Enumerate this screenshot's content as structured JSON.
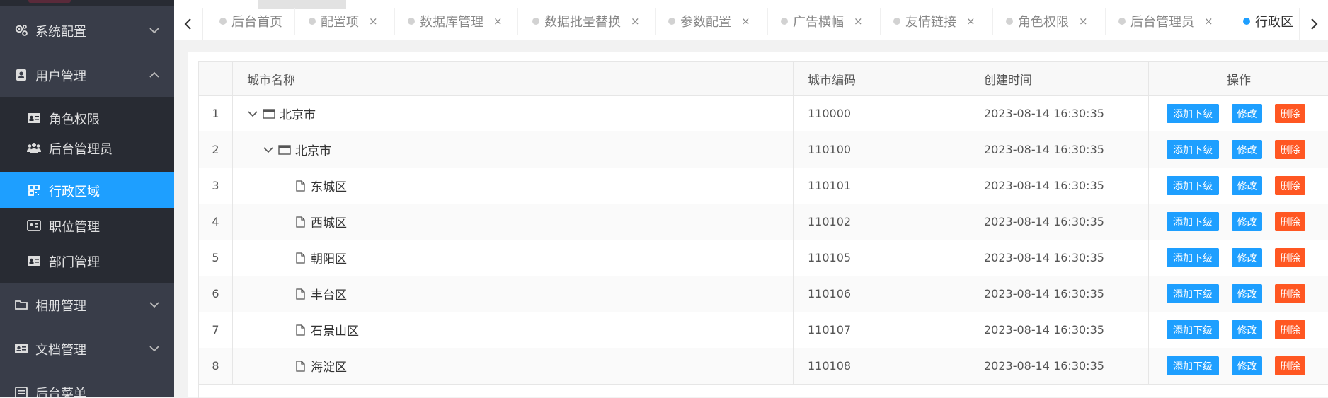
{
  "sidebar": {
    "groups": [
      {
        "label": "系统配置",
        "icon": "gears-icon",
        "expanded": false
      },
      {
        "label": "用户管理",
        "icon": "user-card-icon",
        "expanded": true
      },
      {
        "label": "相册管理",
        "icon": "folder-icon",
        "expanded": false
      },
      {
        "label": "文档管理",
        "icon": "id-card-icon",
        "expanded": false
      },
      {
        "label": "后台菜单",
        "icon": "menu-icon",
        "expanded": false
      }
    ],
    "sub_items": [
      {
        "label": "角色权限",
        "icon": "id-card-icon",
        "active": false
      },
      {
        "label": "后台管理员",
        "icon": "users-icon",
        "active": false
      },
      {
        "label": "行政区域",
        "icon": "qrcode-icon",
        "active": true
      },
      {
        "label": "职位管理",
        "icon": "id-card-icon",
        "active": false
      },
      {
        "label": "部门管理",
        "icon": "id-card-icon",
        "active": false
      }
    ],
    "colors": {
      "bg": "#393d49",
      "sub_bg": "#282b33",
      "active": "#1e9fff"
    }
  },
  "tabs": {
    "items": [
      {
        "label": "后台首页",
        "closable": false
      },
      {
        "label": "配置项",
        "closable": true
      },
      {
        "label": "数据库管理",
        "closable": true
      },
      {
        "label": "数据批量替换",
        "closable": true
      },
      {
        "label": "参数配置",
        "closable": true
      },
      {
        "label": "广告横幅",
        "closable": true
      },
      {
        "label": "友情链接",
        "closable": true
      },
      {
        "label": "角色权限",
        "closable": true
      },
      {
        "label": "后台管理员",
        "closable": true
      },
      {
        "label": "行政区",
        "closable": false,
        "current": true
      }
    ],
    "close_glyph": "×"
  },
  "table": {
    "headers": {
      "name": "城市名称",
      "code": "城市编码",
      "time": "创建时间",
      "ops": "操作"
    },
    "buttons": {
      "add": "添加下级",
      "edit": "修改",
      "delete": "删除"
    },
    "rows": [
      {
        "idx": "1",
        "name": "北京市",
        "code": "110000",
        "time": "2023-08-14 16:30:35",
        "level": 0,
        "kind": "folder"
      },
      {
        "idx": "2",
        "name": "北京市",
        "code": "110100",
        "time": "2023-08-14 16:30:35",
        "level": 1,
        "kind": "folder"
      },
      {
        "idx": "3",
        "name": "东城区",
        "code": "110101",
        "time": "2023-08-14 16:30:35",
        "level": 2,
        "kind": "file"
      },
      {
        "idx": "4",
        "name": "西城区",
        "code": "110102",
        "time": "2023-08-14 16:30:35",
        "level": 2,
        "kind": "file"
      },
      {
        "idx": "5",
        "name": "朝阳区",
        "code": "110105",
        "time": "2023-08-14 16:30:35",
        "level": 2,
        "kind": "file"
      },
      {
        "idx": "6",
        "name": "丰台区",
        "code": "110106",
        "time": "2023-08-14 16:30:35",
        "level": 2,
        "kind": "file"
      },
      {
        "idx": "7",
        "name": "石景山区",
        "code": "110107",
        "time": "2023-08-14 16:30:35",
        "level": 2,
        "kind": "file"
      },
      {
        "idx": "8",
        "name": "海淀区",
        "code": "110108",
        "time": "2023-08-14 16:30:35",
        "level": 2,
        "kind": "file"
      }
    ],
    "colors": {
      "primary": "#1e9fff",
      "danger": "#ff5722"
    }
  }
}
